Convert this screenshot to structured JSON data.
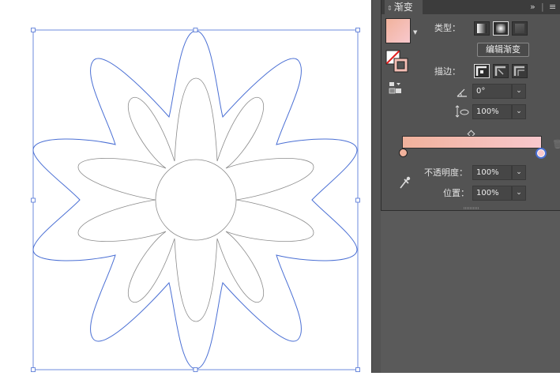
{
  "panel": {
    "title": "渐变",
    "more_icon": "double-chevron-right-icon",
    "menu_icon": "hamburger-menu-icon",
    "type_label": "类型：",
    "edit_gradient_label": "编辑渐变",
    "stroke_label": "描边：",
    "angle_value": "0°",
    "aspect_value": "100%",
    "opacity_label": "不透明度：",
    "opacity_value": "100%",
    "location_label": "位置：",
    "location_value": "100%",
    "gradient_colors": [
      "#f1b29c",
      "#f8c8cd"
    ],
    "accent_color": "#4a6fd4"
  }
}
